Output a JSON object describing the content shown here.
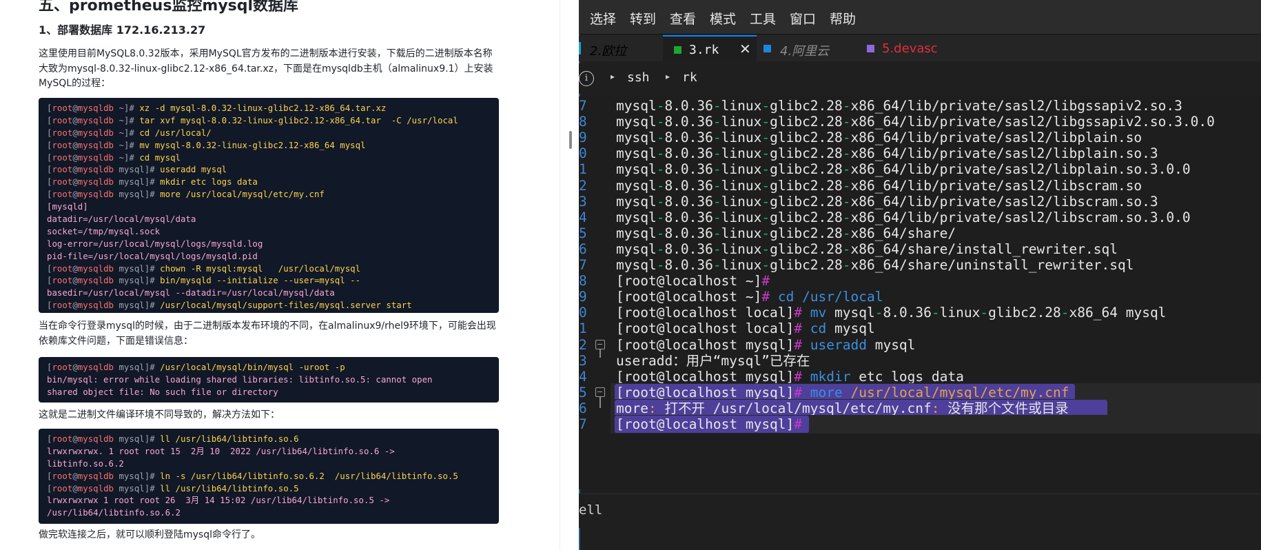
{
  "article": {
    "title": "五、prometheus监控mysql数据库",
    "section": "1、部署数据库   172.16.213.27",
    "para1": "这里使用目前MySQL8.0.32版本，采用MySQL官方发布的二进制版本进行安装，下载后的二进制版本名称大致为mysql-8.0.32-linux-glibc2.12-x86_64.tar.xz，下面是在mysqldb主机（almalinux9.1）上安装MySQL的过程：",
    "code1": [
      {
        "p": [
          "[",
          "root",
          "@",
          "mysqldb",
          " ~",
          "]# "
        ],
        "c": "xz -d mysql-8.0.32-linux-glibc2.12-x86_64.tar.xz"
      },
      {
        "p": [
          "[",
          "root",
          "@",
          "mysqldb",
          " ~",
          "]# "
        ],
        "c": "tar xvf mysql-8.0.32-linux-glibc2.12-x86_64.tar  -C /usr/local"
      },
      {
        "p": [
          "[",
          "root",
          "@",
          "mysqldb",
          " ~",
          "]# "
        ],
        "c": "cd /usr/local/"
      },
      {
        "p": [
          "[",
          "root",
          "@",
          "mysqldb",
          " ~",
          "]# "
        ],
        "c": "mv mysql-8.0.32-linux-glibc2.12-x86_64 mysql"
      },
      {
        "p": [
          "[",
          "root",
          "@",
          "mysqldb",
          " ~",
          "]# "
        ],
        "c": "cd mysql"
      },
      {
        "p": [
          "[",
          "root",
          "@",
          "mysqldb",
          " mysql",
          "]# "
        ],
        "c": "useradd mysql"
      },
      {
        "p": [
          "[",
          "root",
          "@",
          "mysqldb",
          " mysql",
          "]# "
        ],
        "c": "mkdir etc logs data"
      },
      {
        "p": [
          "[",
          "root",
          "@",
          "mysqldb",
          " mysql",
          "]# "
        ],
        "c": "more /usr/local/mysql/etc/my.cnf"
      },
      {
        "o": "[mysqld]"
      },
      {
        "o": "datadir=/usr/local/mysql/data"
      },
      {
        "o": "socket=/tmp/mysql.sock"
      },
      {
        "o": "log-error=/usr/local/mysql/logs/mysqld.log"
      },
      {
        "o": "pid-file=/usr/local/mysql/logs/mysqld.pid"
      },
      {
        "p": [
          "[",
          "root",
          "@",
          "mysqldb",
          " mysql",
          "]# "
        ],
        "c": "chown -R mysql:mysql   /usr/local/mysql"
      },
      {
        "p": [
          "[",
          "root",
          "@",
          "mysqldb",
          " mysql",
          "]# "
        ],
        "c": "bin/mysqld --initialize --user=mysql --"
      },
      {
        "o": "basedir=/usr/local/mysql --datadir=/usr/local/mysql/data"
      },
      {
        "p": [
          "[",
          "root",
          "@",
          "mysqldb",
          " mysql",
          "]# "
        ],
        "c": "/usr/local/mysql/support-files/mysql.server start"
      }
    ],
    "para2": "当在命令行登录mysql的时候，由于二进制版本发布环境的不同，在almalinux9/rhel9环境下，可能会出现依赖库文件问题，下面是错误信息：",
    "code2": [
      {
        "p": [
          "[",
          "root",
          "@",
          "mysqldb",
          " mysql",
          "]# "
        ],
        "c": "/usr/local/mysql/bin/mysql -uroot -p"
      },
      {
        "o": "bin/mysql: error while loading shared libraries: libtinfo.so.5: cannot open"
      },
      {
        "o": "shared object file: No such file or directory"
      }
    ],
    "para3": "这就是二进制文件编译环境不同导致的，解决方法如下：",
    "code3": [
      {
        "p": [
          "[",
          "root",
          "@",
          "mysqldb",
          " mysql",
          "]# "
        ],
        "c": "ll /usr/lib64/libtinfo.so.6"
      },
      {
        "o": "lrwxrwxrwx. 1 root root 15  2月 10  2022 /usr/lib64/libtinfo.so.6 ->"
      },
      {
        "o": "libtinfo.so.6.2"
      },
      {
        "p": [
          "[",
          "root",
          "@",
          "mysqldb",
          " mysql",
          "]# "
        ],
        "c": "ln -s /usr/lib64/libtinfo.so.6.2  /usr/lib64/libtinfo.so.5"
      },
      {
        "p": [
          "[",
          "root",
          "@",
          "mysqldb",
          " mysql",
          "]# "
        ],
        "c": "ll /usr/lib64/libtinfo.so.5"
      },
      {
        "o": "lrwxrwxrwx 1 root root 26  3月 14 15:02 /usr/lib64/libtinfo.so.5 ->"
      },
      {
        "o": "/usr/lib64/libtinfo.so.6.2"
      }
    ],
    "para4": "做完软连接之后，就可以顺利登陆mysql命令行了。"
  },
  "terminal": {
    "menu": [
      "选择",
      "转到",
      "查看",
      "模式",
      "工具",
      "窗口",
      "帮助"
    ],
    "tabs": [
      {
        "label": "2.欧拉",
        "color": "#8a8a8a",
        "sq": ""
      },
      {
        "label": "3.rk",
        "color": "#f0f0f0",
        "sq": "#1fa52f",
        "active": true
      },
      {
        "label": "4.阿里云",
        "color": "#8a8a8a",
        "sq": "#1f86e0"
      },
      {
        "label": "5.devasc",
        "color": "#e0303a",
        "sq": "#8c6ad8"
      }
    ],
    "tab_close": "✕",
    "info_icon": "i",
    "breadcrumb": [
      "ssh",
      "rk"
    ],
    "lines": [
      {
        "n": "7",
        "segs": [
          [
            "mysql"
          ],
          [
            "-",
            "d"
          ],
          [
            "8.0.36"
          ],
          [
            "-",
            "d"
          ],
          [
            "linux"
          ],
          [
            "-",
            "d"
          ],
          [
            "glibc2.28"
          ],
          [
            "-",
            "d"
          ],
          [
            "x86_64/lib/private/sasl2/libgssapiv2.so.3"
          ]
        ]
      },
      {
        "n": "8",
        "segs": [
          [
            "mysql"
          ],
          [
            "-",
            "d"
          ],
          [
            "8.0.36"
          ],
          [
            "-",
            "d"
          ],
          [
            "linux"
          ],
          [
            "-",
            "d"
          ],
          [
            "glibc2.28"
          ],
          [
            "-",
            "d"
          ],
          [
            "x86_64/lib/private/sasl2/libgssapiv2.so.3.0.0"
          ]
        ]
      },
      {
        "n": "9",
        "segs": [
          [
            "mysql"
          ],
          [
            "-",
            "d"
          ],
          [
            "8.0.36"
          ],
          [
            "-",
            "d"
          ],
          [
            "linux"
          ],
          [
            "-",
            "d"
          ],
          [
            "glibc2.28"
          ],
          [
            "-",
            "d"
          ],
          [
            "x86_64/lib/private/sasl2/libplain.so"
          ]
        ]
      },
      {
        "n": "0",
        "segs": [
          [
            "mysql"
          ],
          [
            "-",
            "d"
          ],
          [
            "8.0.36"
          ],
          [
            "-",
            "d"
          ],
          [
            "linux"
          ],
          [
            "-",
            "d"
          ],
          [
            "glibc2.28"
          ],
          [
            "-",
            "d"
          ],
          [
            "x86_64/lib/private/sasl2/libplain.so.3"
          ]
        ]
      },
      {
        "n": "1",
        "segs": [
          [
            "mysql"
          ],
          [
            "-",
            "d"
          ],
          [
            "8.0.36"
          ],
          [
            "-",
            "d"
          ],
          [
            "linux"
          ],
          [
            "-",
            "d"
          ],
          [
            "glibc2.28"
          ],
          [
            "-",
            "d"
          ],
          [
            "x86_64/lib/private/sasl2/libplain.so.3.0.0"
          ]
        ]
      },
      {
        "n": "2",
        "segs": [
          [
            "mysql"
          ],
          [
            "-",
            "d"
          ],
          [
            "8.0.36"
          ],
          [
            "-",
            "d"
          ],
          [
            "linux"
          ],
          [
            "-",
            "d"
          ],
          [
            "glibc2.28"
          ],
          [
            "-",
            "d"
          ],
          [
            "x86_64/lib/private/sasl2/libscram.so"
          ]
        ]
      },
      {
        "n": "3",
        "segs": [
          [
            "mysql"
          ],
          [
            "-",
            "d"
          ],
          [
            "8.0.36"
          ],
          [
            "-",
            "d"
          ],
          [
            "linux"
          ],
          [
            "-",
            "d"
          ],
          [
            "glibc2.28"
          ],
          [
            "-",
            "d"
          ],
          [
            "x86_64/lib/private/sasl2/libscram.so.3"
          ]
        ]
      },
      {
        "n": "4",
        "segs": [
          [
            "mysql"
          ],
          [
            "-",
            "d"
          ],
          [
            "8.0.36"
          ],
          [
            "-",
            "d"
          ],
          [
            "linux"
          ],
          [
            "-",
            "d"
          ],
          [
            "glibc2.28"
          ],
          [
            "-",
            "d"
          ],
          [
            "x86_64/lib/private/sasl2/libscram.so.3.0.0"
          ]
        ]
      },
      {
        "n": "5",
        "segs": [
          [
            "mysql"
          ],
          [
            "-",
            "d"
          ],
          [
            "8.0.36"
          ],
          [
            "-",
            "d"
          ],
          [
            "linux"
          ],
          [
            "-",
            "d"
          ],
          [
            "glibc2.28"
          ],
          [
            "-",
            "d"
          ],
          [
            "x86_64/share/"
          ]
        ]
      },
      {
        "n": "6",
        "segs": [
          [
            "mysql"
          ],
          [
            "-",
            "d"
          ],
          [
            "8.0.36"
          ],
          [
            "-",
            "d"
          ],
          [
            "linux"
          ],
          [
            "-",
            "d"
          ],
          [
            "glibc2.28"
          ],
          [
            "-",
            "d"
          ],
          [
            "x86_64/share/install_rewriter.sql"
          ]
        ]
      },
      {
        "n": "7",
        "segs": [
          [
            "mysql"
          ],
          [
            "-",
            "d"
          ],
          [
            "8.0.36"
          ],
          [
            "-",
            "d"
          ],
          [
            "linux"
          ],
          [
            "-",
            "d"
          ],
          [
            "glibc2.28"
          ],
          [
            "-",
            "d"
          ],
          [
            "x86_64/share/uninstall_rewriter.sql"
          ]
        ]
      },
      {
        "n": "8",
        "segs": [
          [
            "[root@localhost ~]"
          ],
          [
            "#",
            "h"
          ]
        ]
      },
      {
        "n": "9",
        "segs": [
          [
            "[root@localhost ~]"
          ],
          [
            "#",
            "h"
          ],
          [
            " "
          ],
          [
            "cd",
            "c"
          ],
          [
            " "
          ],
          [
            "/usr/local",
            "c"
          ]
        ]
      },
      {
        "n": "0",
        "segs": [
          [
            "[root@localhost local]"
          ],
          [
            "#",
            "h"
          ],
          [
            " "
          ],
          [
            "mv",
            "c"
          ],
          [
            " mysql"
          ],
          [
            "-",
            "d"
          ],
          [
            "8.0.36"
          ],
          [
            "-",
            "d"
          ],
          [
            "linux"
          ],
          [
            "-",
            "d"
          ],
          [
            "glibc2.28"
          ],
          [
            "-",
            "d"
          ],
          [
            "x86_64 mysql"
          ]
        ]
      },
      {
        "n": "1",
        "segs": [
          [
            "[root@localhost local]"
          ],
          [
            "#",
            "h"
          ],
          [
            " "
          ],
          [
            "cd",
            "c"
          ],
          [
            " mysql"
          ]
        ]
      },
      {
        "n": "2",
        "fold": "open",
        "segs": [
          [
            "[root@localhost mysql]"
          ],
          [
            "#",
            "h"
          ],
          [
            " "
          ],
          [
            "useradd",
            "c"
          ],
          [
            " mysql"
          ]
        ]
      },
      {
        "n": "3",
        "segs": [
          [
            "useradd：用户“mysql”已存在"
          ]
        ]
      },
      {
        "n": "4",
        "segs": [
          [
            "[root@localhost mysql]"
          ],
          [
            "#",
            "h"
          ],
          [
            " "
          ],
          [
            "mkdir",
            "c"
          ],
          [
            " etc logs data"
          ]
        ]
      },
      {
        "n": "5",
        "fold": "open",
        "hl": true,
        "segs": [
          [
            "[root@localhost mysql]"
          ],
          [
            "#",
            "h"
          ],
          [
            " "
          ],
          [
            "more",
            "c"
          ],
          [
            " "
          ],
          [
            "/usr/local/mysql/etc/my.cnf",
            "e"
          ]
        ]
      },
      {
        "n": "6",
        "hl": true,
        "segs": [
          [
            "more"
          ],
          [
            ":",
            "e"
          ],
          [
            " 打不开 /usr/local/mysql/etc/my.cnf"
          ],
          [
            ":",
            "e"
          ],
          [
            " 没有那个文件或目录"
          ]
        ]
      },
      {
        "n": "7",
        "hl": true,
        "segs": [
          [
            "[root@localhost mysql]"
          ],
          [
            "#",
            "h"
          ]
        ]
      }
    ],
    "status": "ell"
  },
  "colors": {
    "accent": "#0a84ff",
    "selection": "#4d3f9a",
    "code_bg": "#111827",
    "terminal_bg": "#1e1e1e"
  }
}
